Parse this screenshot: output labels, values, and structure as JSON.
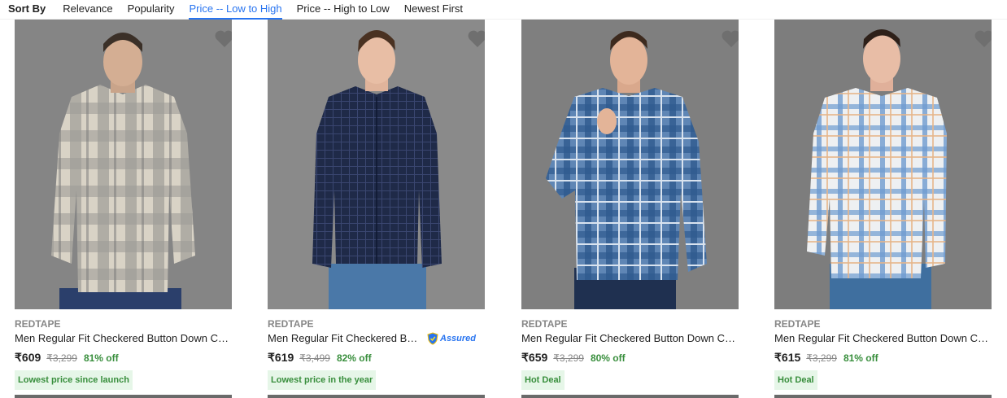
{
  "sort": {
    "label": "Sort By",
    "options": [
      "Relevance",
      "Popularity",
      "Price -- Low to High",
      "Price -- High to Low",
      "Newest First"
    ],
    "active": "Price -- Low to High",
    "accent": "#2874f0"
  },
  "products": [
    {
      "brand": "REDTAPE",
      "title": "Men Regular Fit Checkered Button Down Coll...",
      "price": "₹609",
      "mrp": "₹3,299",
      "off": "81% off",
      "badge": "Lowest price since launch",
      "image": "man-in-grey-beige-check-shirt"
    },
    {
      "brand": "REDTAPE",
      "title": "Men Regular Fit Checkered Butt...",
      "price": "₹619",
      "mrp": "₹3,499",
      "off": "82% off",
      "badge": "Lowest price in the year",
      "assured": "Assured",
      "image": "man-in-navy-check-shirt"
    },
    {
      "brand": "REDTAPE",
      "title": "Men Regular Fit Checkered Button Down Coll...",
      "price": "₹659",
      "mrp": "₹3,299",
      "off": "80% off",
      "badge": "Hot Deal",
      "image": "man-in-blue-check-shirt"
    },
    {
      "brand": "REDTAPE",
      "title": "Men Regular Fit Checkered Button Down Coll...",
      "price": "₹615",
      "mrp": "₹3,299",
      "off": "81% off",
      "badge": "Hot Deal",
      "image": "man-in-white-blue-check-shirt"
    }
  ],
  "colors": {
    "brand_text": "#878787",
    "discount": "#388e3c",
    "badge_bg": "#e6f6e8"
  },
  "icons": {
    "wishlist": "heart-icon",
    "assured": "assured-shield-icon"
  }
}
